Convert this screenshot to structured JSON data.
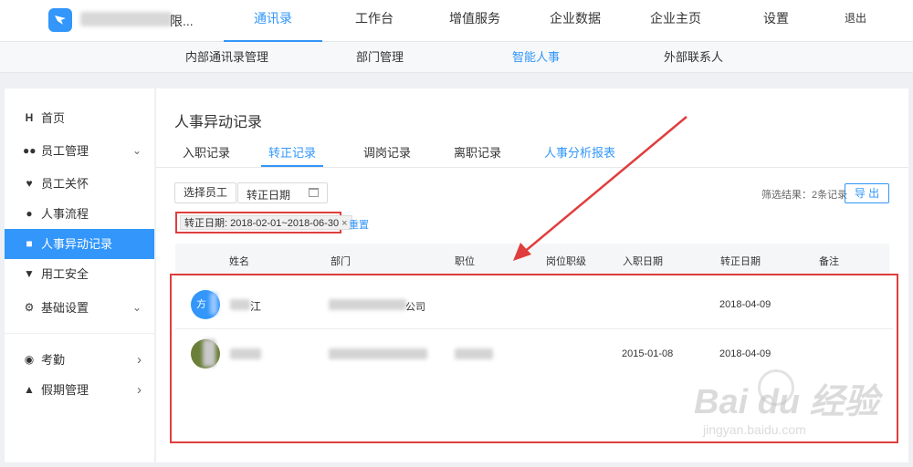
{
  "header": {
    "company_suffix": "限...",
    "nav": [
      "通讯录",
      "工作台",
      "增值服务",
      "企业数据",
      "企业主页",
      "设置"
    ],
    "active_nav": "通讯录",
    "logout": "退出"
  },
  "subnav": {
    "items": [
      "内部通讯录管理",
      "部门管理",
      "智能人事",
      "外部联系人"
    ],
    "active": "智能人事"
  },
  "sidebar": {
    "items": [
      {
        "label": "首页",
        "icon": "home-icon"
      },
      {
        "label": "员工管理",
        "icon": "users-icon",
        "caret": "⌄"
      },
      {
        "label": "员工关怀",
        "icon": "heart-icon"
      },
      {
        "label": "人事流程",
        "icon": "person-icon"
      },
      {
        "label": "人事异动记录",
        "icon": "record-icon",
        "active": true
      },
      {
        "label": "用工安全",
        "icon": "shield-icon"
      },
      {
        "label": "基础设置",
        "icon": "gear-icon",
        "caret": "⌄"
      },
      {
        "label": "考勤",
        "icon": "attendance-icon",
        "caret": "›"
      },
      {
        "label": "假期管理",
        "icon": "vacation-icon",
        "caret": "›"
      }
    ]
  },
  "main": {
    "title": "人事异动记录",
    "tabs": [
      "入职记录",
      "转正记录",
      "调岗记录",
      "离职记录",
      "人事分析报表"
    ],
    "active_tab": "转正记录",
    "select_employee": "选择员工",
    "date_filter_label": "转正日期",
    "filter_result": "筛选结果：2条记录",
    "export": "导 出",
    "chip": "转正日期: 2018-02-01~2018-06-30",
    "chip_close": "×",
    "reset": "重置",
    "columns": [
      "姓名",
      "部门",
      "职位",
      "岗位职级",
      "入职日期",
      "转正日期",
      "备注"
    ],
    "rows": [
      {
        "avatar_text": "方",
        "name_tail": "江",
        "dept_tail": "公司",
        "hire_date": "",
        "regular_date": "2018-04-09"
      },
      {
        "avatar_text": "",
        "name_tail": "",
        "dept_tail": "",
        "hire_date": "2015-01-08",
        "regular_date": "2018-04-09"
      }
    ]
  },
  "watermark": {
    "brand": "Bai du 经验",
    "url": "jingyan.baidu.com"
  },
  "colors": {
    "accent": "#3296fa",
    "highlight_red": "#e03e3e"
  }
}
